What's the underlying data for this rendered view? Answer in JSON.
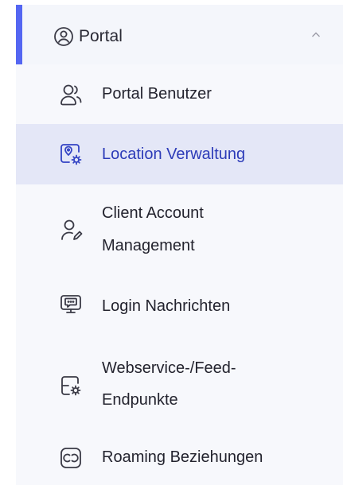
{
  "section": {
    "label": "Portal",
    "icon": "user-circle-icon",
    "chevron": "chevron-up-icon",
    "accent_color": "#5466f2"
  },
  "items": [
    {
      "label": "Portal Benutzer",
      "icon": "users-icon"
    },
    {
      "label": "Location Verwaltung",
      "icon": "location-settings-icon",
      "active": true
    },
    {
      "label": "Client Account",
      "label2": "Management",
      "icon": "user-edit-icon"
    },
    {
      "label": "Login Nachrichten",
      "icon": "message-monitor-icon"
    },
    {
      "label": "Webservice-/Feed-",
      "label2": "Endpunkte",
      "icon": "server-settings-icon"
    },
    {
      "label": "Roaming Beziehungen",
      "icon": "roaming-icon"
    }
  ],
  "colors": {
    "active_bg": "#e4e7f7",
    "active_text": "#2c3bb8"
  }
}
